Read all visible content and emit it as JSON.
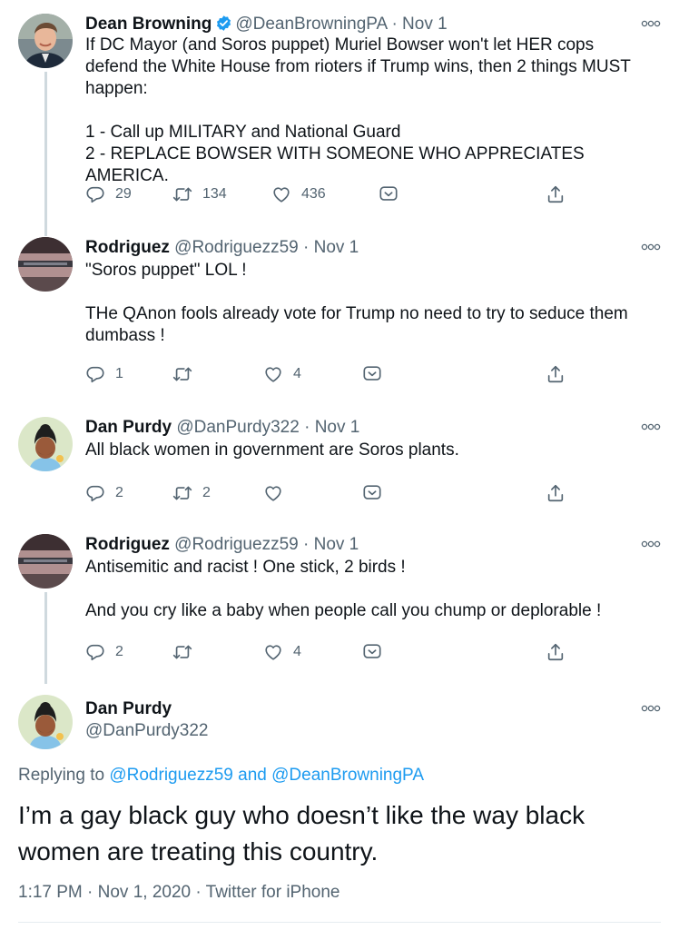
{
  "tweets": [
    {
      "name": "Dean Browning",
      "handle": "@DeanBrowningPA",
      "separator": "·",
      "date": "Nov 1",
      "text_lines": [
        "If DC Mayor (and Soros puppet) Muriel Bowser won't let HER cops",
        "defend the White House from rioters if Trump wins, then 2 things MUST",
        "happen:",
        "",
        "1 - Call up MILITARY and National Guard",
        "2 - REPLACE BOWSER WITH SOMEONE WHO APPRECIATES AMERICA."
      ],
      "replies": "29",
      "retweets": "134",
      "likes": "436"
    },
    {
      "name": "Rodriguez",
      "handle": "@Rodriguezz59",
      "separator": "·",
      "date": "Nov 1",
      "text_lines": [
        "\"Soros puppet\" LOL !",
        "",
        "THe QAnon fools already vote for Trump no need to try to seduce them",
        "dumbass !"
      ],
      "replies": "1",
      "retweets": "",
      "likes": "4"
    },
    {
      "name": "Dan Purdy",
      "handle": "@DanPurdy322",
      "separator": "·",
      "date": "Nov 1",
      "text_lines": [
        "All black women in government are Soros plants."
      ],
      "replies": "2",
      "retweets": "2",
      "likes": ""
    },
    {
      "name": "Rodriguez",
      "handle": "@Rodriguezz59",
      "separator": "·",
      "date": "Nov 1",
      "text_lines": [
        "Antisemitic and racist ! One stick, 2 birds !",
        "",
        "And you cry like a baby when people call you chump or deplorable !"
      ],
      "replies": "2",
      "retweets": "",
      "likes": "4"
    }
  ],
  "focused": {
    "name": "Dan Purdy",
    "handle": "@DanPurdy322",
    "replying_prefix": "Replying to",
    "replying_user1": "@Rodriguezz59",
    "replying_and": "and",
    "replying_user2": "@DeanBrowningPA",
    "text_line1": "I’m a gay black guy who doesn’t like the way black",
    "text_line2": "women are treating this country.",
    "timestamp": "1:17 PM · Nov 1, 2020 · Twitter for iPhone"
  },
  "icons": {
    "reply": "reply-icon",
    "retweet": "retweet-icon",
    "like": "heart-icon",
    "bookmark": "bookmark-icon",
    "share": "share-icon",
    "more": "more-icon",
    "verified": "verified-badge-icon"
  },
  "colors": {
    "accent": "#1d9bf0",
    "secondary_text": "#536471",
    "primary_text": "#0f1419",
    "thread_line": "#cfd9de"
  }
}
